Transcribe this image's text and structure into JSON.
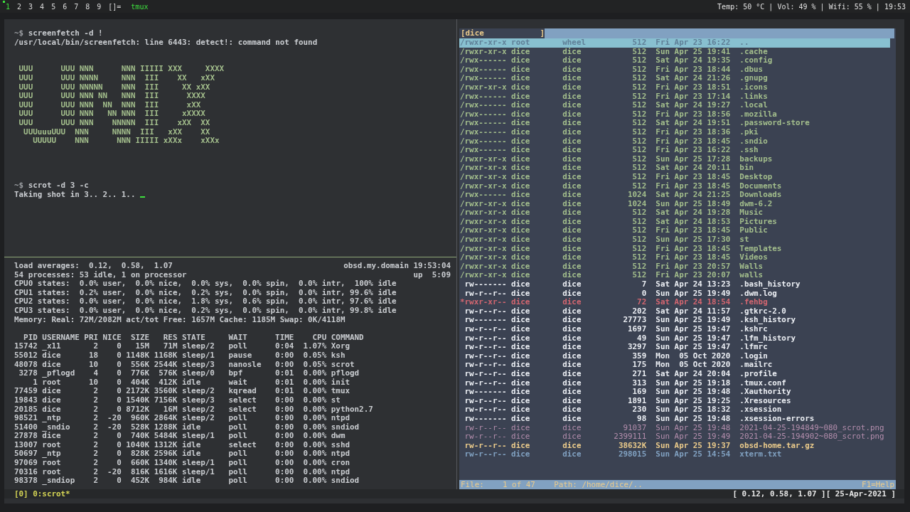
{
  "topbar": {
    "workspaces": [
      {
        "label": "1",
        "selected": true,
        "occupied": true
      },
      {
        "label": "2",
        "selected": false,
        "occupied": false
      },
      {
        "label": "3",
        "selected": false,
        "occupied": false
      },
      {
        "label": "4",
        "selected": false,
        "occupied": false
      },
      {
        "label": "5",
        "selected": false,
        "occupied": false
      },
      {
        "label": "6",
        "selected": false,
        "occupied": false
      },
      {
        "label": "7",
        "selected": false,
        "occupied": false
      },
      {
        "label": "8",
        "selected": false,
        "occupied": false
      },
      {
        "label": "9",
        "selected": false,
        "occupied": false
      }
    ],
    "layout": "[]=",
    "window_title": "tmux",
    "status": "Temp: 50 °C | Vol: 49 % | Wifi: 55 % | 19:53"
  },
  "shell": {
    "blocks": [
      {
        "kind": "prompt",
        "prompt": "~$",
        "command": "screenfetch -d !"
      },
      {
        "kind": "output",
        "text": "/usr/local/bin/screenfetch: line 6443: detect!: command not found"
      },
      {
        "kind": "art",
        "lines": [
          " UUU      UUU NNN      NNN IIIII XXX     XXXX",
          " UUU      UUU NNNN     NNN  III    XX   xXX",
          " UUU      UUU NNNNN    NNN  III     XX xXX",
          " UUU      UUU NNN NN   NNN  III      XXXX",
          " UUU      UUU NNN  NN  NNN  III      xXX",
          " UUU      UUU NNN   NN NNN  III     xXXXX",
          " UUU      UUU NNN    NNNNN  III    xXX  XX",
          "  UUUuuuUUU  NNN     NNNN  III   xXX    XX",
          "    UUUUU    NNN      NNN IIIII xXXx    xXXx"
        ]
      },
      {
        "kind": "prompt",
        "prompt": "~$",
        "command": "scrot -d 3 -c"
      },
      {
        "kind": "output",
        "text": "Taking shot in 3.. 2.. 1..",
        "cursor": true
      }
    ]
  },
  "top": {
    "load": "load averages:  0.12,  0.58,  1.07",
    "host": "obsd.my.domain 19:53:04",
    "processes": "54 processes: 53 idle, 1 on processor",
    "uptime": "up  5:09",
    "cpu_lines": [
      "CPU0 states:  0.0% user,  0.0% nice,  0.0% sys,  0.0% spin,  0.0% intr,  100% idle",
      "CPU1 states:  0.2% user,  0.0% nice,  0.2% sys,  0.0% spin,  0.0% intr, 99.6% idle",
      "CPU2 states:  0.0% user,  0.0% nice,  1.8% sys,  0.6% spin,  0.0% intr, 97.6% idle",
      "CPU3 states:  0.0% user,  0.0% nice,  0.2% sys,  0.0% spin,  0.0% intr, 99.8% idle"
    ],
    "memory": "Memory: Real: 72M/2082M act/tot Free: 1657M Cache: 1185M Swap: 0K/4118M",
    "columns": [
      "PID",
      "USERNAME",
      "PRI",
      "NICE",
      "SIZE",
      "RES",
      "STATE",
      "WAIT",
      "TIME",
      "CPU",
      "COMMAND"
    ],
    "rows": [
      [
        "15742",
        "_x11",
        "2",
        "0",
        "15M",
        "71M",
        "sleep/2",
        "poll",
        "0:04",
        "1.07%",
        "Xorg"
      ],
      [
        "55012",
        "dice",
        "18",
        "0",
        "1148K",
        "1168K",
        "sleep/1",
        "pause",
        "0:00",
        "0.05%",
        "ksh"
      ],
      [
        "48078",
        "dice",
        "10",
        "0",
        "556K",
        "2544K",
        "sleep/3",
        "nanosle",
        "0:00",
        "0.05%",
        "scrot"
      ],
      [
        "3278",
        "_pflogd",
        "4",
        "0",
        "776K",
        "576K",
        "sleep/0",
        "bpf",
        "0:01",
        "0.00%",
        "pflogd"
      ],
      [
        "1",
        "root",
        "10",
        "0",
        "404K",
        "412K",
        "idle",
        "wait",
        "0:01",
        "0.00%",
        "init"
      ],
      [
        "77459",
        "dice",
        "2",
        "0",
        "2172K",
        "3560K",
        "sleep/2",
        "kqread",
        "0:01",
        "0.00%",
        "tmux"
      ],
      [
        "19843",
        "dice",
        "2",
        "0",
        "1540K",
        "7156K",
        "sleep/3",
        "select",
        "0:00",
        "0.00%",
        "st"
      ],
      [
        "20185",
        "dice",
        "2",
        "0",
        "8712K",
        "16M",
        "sleep/2",
        "select",
        "0:00",
        "0.00%",
        "python2.7"
      ],
      [
        "98521",
        "_ntp",
        "2",
        "-20",
        "960K",
        "2864K",
        "sleep/2",
        "poll",
        "0:00",
        "0.00%",
        "ntpd"
      ],
      [
        "51400",
        "_sndio",
        "2",
        "-20",
        "528K",
        "1288K",
        "idle",
        "poll",
        "0:00",
        "0.00%",
        "sndiod"
      ],
      [
        "27878",
        "dice",
        "2",
        "0",
        "740K",
        "5484K",
        "sleep/1",
        "poll",
        "0:00",
        "0.00%",
        "dwm"
      ],
      [
        "13007",
        "root",
        "2",
        "0",
        "1040K",
        "1312K",
        "idle",
        "select",
        "0:00",
        "0.00%",
        "sshd"
      ],
      [
        "50697",
        "_ntp",
        "2",
        "0",
        "828K",
        "2596K",
        "idle",
        "poll",
        "0:00",
        "0.00%",
        "ntpd"
      ],
      [
        "97069",
        "root",
        "2",
        "0",
        "660K",
        "1340K",
        "sleep/1",
        "poll",
        "0:00",
        "0.00%",
        "cron"
      ],
      [
        "70316",
        "root",
        "2",
        "-20",
        "816K",
        "1616K",
        "sleep/1",
        "poll",
        "0:00",
        "0.00%",
        "ntpd"
      ],
      [
        "98378",
        "_sndiop",
        "2",
        "0",
        "452K",
        "984K",
        "idle",
        "poll",
        "0:00",
        "0.00%",
        "sndiod"
      ]
    ]
  },
  "file_manager": {
    "header": "[dice            ]",
    "files": [
      {
        "perm": "/rwxr-xr-x",
        "owner": "root",
        "group": "wheel",
        "size": "512",
        "date": "Fri Apr 23 16:22",
        "name": "..",
        "kind": "directory",
        "selected": true
      },
      {
        "perm": "/rwxr-xr-x",
        "owner": "dice",
        "group": "dice",
        "size": "512",
        "date": "Sun Apr 25 19:41",
        "name": ".cache",
        "kind": "directory",
        "selected": false
      },
      {
        "perm": "/rwx------",
        "owner": "dice",
        "group": "dice",
        "size": "512",
        "date": "Sat Apr 24 19:35",
        "name": ".config",
        "kind": "directory",
        "selected": false
      },
      {
        "perm": "/rwx------",
        "owner": "dice",
        "group": "dice",
        "size": "512",
        "date": "Fri Apr 23 18:44",
        "name": ".dbus",
        "kind": "directory",
        "selected": false
      },
      {
        "perm": "/rwx------",
        "owner": "dice",
        "group": "dice",
        "size": "512",
        "date": "Sat Apr 24 21:26",
        "name": ".gnupg",
        "kind": "directory",
        "selected": false
      },
      {
        "perm": "/rwxr-xr-x",
        "owner": "dice",
        "group": "dice",
        "size": "512",
        "date": "Fri Apr 23 18:51",
        "name": ".icons",
        "kind": "directory",
        "selected": false
      },
      {
        "perm": "/rwx------",
        "owner": "dice",
        "group": "dice",
        "size": "512",
        "date": "Fri Apr 23 17:14",
        "name": ".links",
        "kind": "directory",
        "selected": false
      },
      {
        "perm": "/rwx------",
        "owner": "dice",
        "group": "dice",
        "size": "512",
        "date": "Sat Apr 24 19:27",
        "name": ".local",
        "kind": "directory",
        "selected": false
      },
      {
        "perm": "/rwx------",
        "owner": "dice",
        "group": "dice",
        "size": "512",
        "date": "Fri Apr 23 18:56",
        "name": ".mozilla",
        "kind": "directory",
        "selected": false
      },
      {
        "perm": "/rwx------",
        "owner": "dice",
        "group": "dice",
        "size": "512",
        "date": "Sat Apr 24 19:51",
        "name": ".password-store",
        "kind": "directory",
        "selected": false
      },
      {
        "perm": "/rwx------",
        "owner": "dice",
        "group": "dice",
        "size": "512",
        "date": "Fri Apr 23 18:36",
        "name": ".pki",
        "kind": "directory",
        "selected": false
      },
      {
        "perm": "/rwx------",
        "owner": "dice",
        "group": "dice",
        "size": "512",
        "date": "Fri Apr 23 18:45",
        "name": ".sndio",
        "kind": "directory",
        "selected": false
      },
      {
        "perm": "/rwx------",
        "owner": "dice",
        "group": "dice",
        "size": "512",
        "date": "Fri Apr 23 16:22",
        "name": ".ssh",
        "kind": "directory",
        "selected": false
      },
      {
        "perm": "/rwxr-xr-x",
        "owner": "dice",
        "group": "dice",
        "size": "512",
        "date": "Sun Apr 25 17:28",
        "name": "backups",
        "kind": "directory",
        "selected": false
      },
      {
        "perm": "/rwxr-xr-x",
        "owner": "dice",
        "group": "dice",
        "size": "512",
        "date": "Sat Apr 24 20:11",
        "name": "bin",
        "kind": "directory",
        "selected": false
      },
      {
        "perm": "/rwxr-xr-x",
        "owner": "dice",
        "group": "dice",
        "size": "512",
        "date": "Fri Apr 23 18:45",
        "name": "Desktop",
        "kind": "directory",
        "selected": false
      },
      {
        "perm": "/rwxr-xr-x",
        "owner": "dice",
        "group": "dice",
        "size": "512",
        "date": "Fri Apr 23 18:45",
        "name": "Documents",
        "kind": "directory",
        "selected": false
      },
      {
        "perm": "/rwx------",
        "owner": "dice",
        "group": "dice",
        "size": "1024",
        "date": "Sat Apr 24 21:25",
        "name": "Downloads",
        "kind": "directory",
        "selected": false
      },
      {
        "perm": "/rwxr-xr-x",
        "owner": "dice",
        "group": "dice",
        "size": "1024",
        "date": "Sun Apr 25 18:49",
        "name": "dwm-6.2",
        "kind": "directory",
        "selected": false
      },
      {
        "perm": "/rwxr-xr-x",
        "owner": "dice",
        "group": "dice",
        "size": "512",
        "date": "Sat Apr 24 19:28",
        "name": "Music",
        "kind": "directory",
        "selected": false
      },
      {
        "perm": "/rwxr-xr-x",
        "owner": "dice",
        "group": "dice",
        "size": "512",
        "date": "Sat Apr 24 18:53",
        "name": "Pictures",
        "kind": "directory",
        "selected": false
      },
      {
        "perm": "/rwxr-xr-x",
        "owner": "dice",
        "group": "dice",
        "size": "512",
        "date": "Fri Apr 23 18:45",
        "name": "Public",
        "kind": "directory",
        "selected": false
      },
      {
        "perm": "/rwxr-xr-x",
        "owner": "dice",
        "group": "dice",
        "size": "512",
        "date": "Sun Apr 25 17:30",
        "name": "st",
        "kind": "directory",
        "selected": false
      },
      {
        "perm": "/rwxr-xr-x",
        "owner": "dice",
        "group": "dice",
        "size": "512",
        "date": "Fri Apr 23 18:45",
        "name": "Templates",
        "kind": "directory",
        "selected": false
      },
      {
        "perm": "/rwxr-xr-x",
        "owner": "dice",
        "group": "dice",
        "size": "512",
        "date": "Fri Apr 23 18:45",
        "name": "Videos",
        "kind": "directory",
        "selected": false
      },
      {
        "perm": "/rwxr-xr-x",
        "owner": "dice",
        "group": "dice",
        "size": "512",
        "date": "Fri Apr 23 20:57",
        "name": "Walls",
        "kind": "directory",
        "selected": false
      },
      {
        "perm": "/rwxr-xr-x",
        "owner": "dice",
        "group": "dice",
        "size": "512",
        "date": "Fri Apr 23 20:07",
        "name": "walls",
        "kind": "directory",
        "selected": false
      },
      {
        "perm": "rw-------",
        "owner": "dice",
        "group": "dice",
        "size": "7",
        "date": "Sat Apr 24 13:23",
        "name": ".bash_history",
        "kind": "file",
        "selected": false
      },
      {
        "perm": "rw-r--r--",
        "owner": "dice",
        "group": "dice",
        "size": "0",
        "date": "Sun Apr 25 19:49",
        "name": ".dwm.log",
        "kind": "file",
        "selected": false
      },
      {
        "perm": "*rwxr-xr--",
        "owner": "dice",
        "group": "dice",
        "size": "72",
        "date": "Sat Apr 24 18:54",
        "name": ".fehbg",
        "kind": "executable",
        "selected": false
      },
      {
        "perm": "rw-r--r--",
        "owner": "dice",
        "group": "dice",
        "size": "202",
        "date": "Sat Apr 24 11:57",
        "name": ".gtkrc-2.0",
        "kind": "file",
        "selected": false
      },
      {
        "perm": "rw-------",
        "owner": "dice",
        "group": "dice",
        "size": "27773",
        "date": "Sun Apr 25 19:49",
        "name": ".ksh_history",
        "kind": "file",
        "selected": false
      },
      {
        "perm": "rw-r--r--",
        "owner": "dice",
        "group": "dice",
        "size": "1697",
        "date": "Sun Apr 25 19:47",
        "name": ".kshrc",
        "kind": "file",
        "selected": false
      },
      {
        "perm": "rw-r--r--",
        "owner": "dice",
        "group": "dice",
        "size": "49",
        "date": "Sun Apr 25 19:47",
        "name": ".lfm_history",
        "kind": "file",
        "selected": false
      },
      {
        "perm": "rw-r--r--",
        "owner": "dice",
        "group": "dice",
        "size": "3297",
        "date": "Sun Apr 25 19:47",
        "name": ".lfmrc",
        "kind": "file",
        "selected": false
      },
      {
        "perm": "rw-r--r--",
        "owner": "dice",
        "group": "dice",
        "size": "359",
        "date": "Mon  05 Oct 2020",
        "name": ".login",
        "kind": "file",
        "selected": false
      },
      {
        "perm": "rw-r--r--",
        "owner": "dice",
        "group": "dice",
        "size": "175",
        "date": "Mon  05 Oct 2020",
        "name": ".mailrc",
        "kind": "file",
        "selected": false
      },
      {
        "perm": "rw-r--r--",
        "owner": "dice",
        "group": "dice",
        "size": "271",
        "date": "Sat Apr 24 20:04",
        "name": ".profile",
        "kind": "file",
        "selected": false
      },
      {
        "perm": "rw-r--r--",
        "owner": "dice",
        "group": "dice",
        "size": "313",
        "date": "Sun Apr 25 19:18",
        "name": ".tmux.conf",
        "kind": "file",
        "selected": false
      },
      {
        "perm": "rw-------",
        "owner": "dice",
        "group": "dice",
        "size": "169",
        "date": "Sun Apr 25 19:48",
        "name": ".Xauthority",
        "kind": "file",
        "selected": false
      },
      {
        "perm": "rw-r--r--",
        "owner": "dice",
        "group": "dice",
        "size": "1891",
        "date": "Sun Apr 25 19:25",
        "name": ".Xresources",
        "kind": "file",
        "selected": false
      },
      {
        "perm": "rw-r--r--",
        "owner": "dice",
        "group": "dice",
        "size": "230",
        "date": "Sun Apr 25 18:32",
        "name": ".xsession",
        "kind": "file",
        "selected": false
      },
      {
        "perm": "rw-------",
        "owner": "dice",
        "group": "dice",
        "size": "98",
        "date": "Sun Apr 25 19:48",
        "name": ".xsession-errors",
        "kind": "file",
        "selected": false
      },
      {
        "perm": "rw-r--r--",
        "owner": "dice",
        "group": "dice",
        "size": "91037",
        "date": "Sun Apr 25 19:48",
        "name": "2021-04-25-194849~080_scrot.png",
        "kind": "image",
        "selected": false
      },
      {
        "perm": "rw-r--r--",
        "owner": "dice",
        "group": "dice",
        "size": "2399111",
        "date": "Sun Apr 25 19:49",
        "name": "2021-04-25-194902~080_scrot.png",
        "kind": "image",
        "selected": false
      },
      {
        "perm": "rw-r--r--",
        "owner": "dice",
        "group": "dice",
        "size": "38632K",
        "date": "Sun Apr 25 19:37",
        "name": "obsd-home.tar.gz",
        "kind": "archive",
        "selected": false
      },
      {
        "perm": "rw-r--r--",
        "owner": "dice",
        "group": "dice",
        "size": "298015",
        "date": "Sun Apr 25 14:54",
        "name": "xterm.txt",
        "kind": "document",
        "selected": false
      }
    ],
    "footer": {
      "position": "File:    1 of 47",
      "path": "Path: /home/dice/..",
      "help": "F1=Help"
    }
  },
  "tmux": {
    "session": "[0] 0:scrot*",
    "right": "[ 0.12, 0.58, 1.07 ][ 25-Apr-2021 ]"
  }
}
